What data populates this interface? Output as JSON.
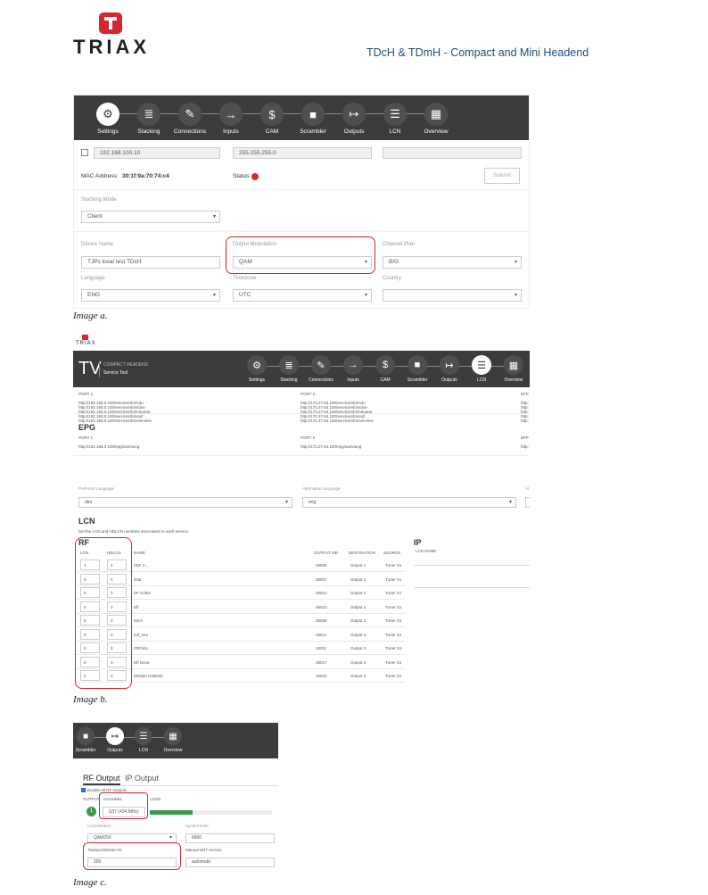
{
  "header": {
    "brand": "TRIAX",
    "doc_title": "TDcH & TDmH  -  Compact and Mini Headend"
  },
  "captions": {
    "a": "Image a.",
    "b": "Image b.",
    "c": "Image c."
  },
  "image_a": {
    "nav": [
      {
        "label": "Settings",
        "icon": "gear-icon",
        "glyph": "⚙",
        "active": true
      },
      {
        "label": "Stacking",
        "icon": "stack-icon",
        "glyph": "≣",
        "active": false
      },
      {
        "label": "Connections",
        "icon": "plug-icon",
        "glyph": "✎",
        "active": false
      },
      {
        "label": "Inputs",
        "icon": "input-icon",
        "glyph": "→",
        "active": false
      },
      {
        "label": "CAM",
        "icon": "cam-icon",
        "glyph": "$",
        "active": false
      },
      {
        "label": "Scrambler",
        "icon": "lock-icon",
        "glyph": "■",
        "active": false
      },
      {
        "label": "Outputs",
        "icon": "output-icon",
        "glyph": "↦",
        "active": false
      },
      {
        "label": "LCN",
        "icon": "list-icon",
        "glyph": "☰",
        "active": false
      },
      {
        "label": "Overview",
        "icon": "grid-icon",
        "glyph": "▦",
        "active": false
      }
    ],
    "ip": "192.168.100.10",
    "mask": "255.255.255.0",
    "mac_label": "MAC Address:",
    "mac_value": "30:1f:9a:70:74:c4",
    "status_label": "Status:",
    "submit": "Submit",
    "stacking_mode_label": "Stacking Mode",
    "stacking_mode_value": "Client",
    "device_name_label": "Device Name",
    "device_name_value": "TJPs local test TDcH",
    "output_mod_label": "Output Modulation",
    "output_mod_value": "QAM",
    "channel_plan_label": "Channel Plan",
    "channel_plan_value": "B/G",
    "language_label": "Language",
    "language_value": "ENG",
    "timezone_label": "Timezone",
    "timezone_value": "UTC",
    "country_label": "Country"
  },
  "image_b": {
    "small_brand": "TRIAX",
    "tv": "TV",
    "app_line1": "COMPACT HEADEND",
    "app_line2": "Service Tool",
    "nav": [
      "Settings",
      "Stacking",
      "Connections",
      "Inputs",
      "CAM",
      "Scrambler",
      "Outputs",
      "LCN",
      "Overview"
    ],
    "port1": "PORT 1",
    "port2": "PORT 2",
    "sfp": "SFP",
    "port1_urls": [
      "http://192.168.0.100/serviceinfo/m3u",
      "http://192.168.0.100/serviceinfo/vidue",
      "http://192.168.0.100/serviceinfo/m3uepp",
      "http://192.168.0.100/serviceinfo/xspf",
      "http://192.168.0.100/serviceinfo/overview"
    ],
    "port2_urls": [
      "http://172.27.64.100/serviceinfo/m3u",
      "http://172.27.64.100/serviceinfo/vidue",
      "http://172.27.64.100/serviceinfo/m3uepp",
      "http://172.27.64.100/serviceinfo/xspf",
      "http://172.27.64.100/serviceinfo/overview"
    ],
    "sfp_urls": [
      "http:",
      "http:",
      "http:",
      "http:",
      "http:"
    ],
    "epg_title": "EPG",
    "epg_port1": "http://192.168.0.100/epg/samsung",
    "epg_port2": "http://172.27.64.100/epg/samsung",
    "epg_sfp": "http:",
    "pref_lang_label": "Preferred Language",
    "pref_lang_value": "deu",
    "alt_lang_label": "Alternative Language",
    "alt_lang_value": "eng",
    "alt_cut": "Al",
    "lcn_title": "LCN",
    "lcn_desc": "Set the LCN and HDLCN numbers associated to each service.",
    "rf_title": "RF",
    "ip_title": "IP",
    "ip_cols": "LCN  NAME",
    "cols": {
      "lcn": "LCN",
      "hdlcn": "HDLCN",
      "name": "NAME",
      "sid": "OUTPUT SID",
      "dest": "DESTINATION",
      "src": "SOURCE"
    },
    "rows": [
      {
        "lcn": "4",
        "hdlcn": "4",
        "name": "ZDF 2...",
        "sid": "28006",
        "dest": "Output 1",
        "src": "Tuner S1"
      },
      {
        "lcn": "0",
        "hdlcn": "0",
        "name": "3sat",
        "sid": "28007",
        "dest": "Output 2",
        "src": "Tuner S1"
      },
      {
        "lcn": "0",
        "hdlcn": "0",
        "name": "DF Kultur",
        "sid": "28012",
        "dest": "Output 2",
        "src": "Tuner S1"
      },
      {
        "lcn": "0",
        "hdlcn": "0",
        "name": "Dlf",
        "sid": "28013",
        "dest": "Output 2",
        "src": "Tuner S1"
      },
      {
        "lcn": "0",
        "hdlcn": "0",
        "name": "KiKA",
        "sid": "28008",
        "dest": "Output 3",
        "src": "Tuner S1"
      },
      {
        "lcn": "0",
        "hdlcn": "0",
        "name": "zdf_neo",
        "sid": "28014",
        "dest": "Output 3",
        "src": "Tuner S1"
      },
      {
        "lcn": "0",
        "hdlcn": "0",
        "name": "ZDFinfo",
        "sid": "28011",
        "dest": "Output 3",
        "src": "Tuner S1"
      },
      {
        "lcn": "0",
        "hdlcn": "0",
        "name": "Dlf Nova",
        "sid": "28017",
        "dest": "Output 3",
        "src": "Tuner S1"
      },
      {
        "lcn": "0",
        "hdlcn": "0",
        "name": "DRadio DokDeb",
        "sid": "28015",
        "dest": "Output 3",
        "src": "Tuner S1"
      }
    ]
  },
  "image_c": {
    "nav": [
      {
        "label": "Scrambler",
        "glyph": "■",
        "icon": "lock-icon",
        "active": false
      },
      {
        "label": "Outputs",
        "glyph": "↦",
        "icon": "output-icon",
        "active": true
      },
      {
        "label": "LCN",
        "glyph": "☰",
        "icon": "list-icon",
        "active": false
      },
      {
        "label": "Overview",
        "glyph": "▦",
        "icon": "grid-icon",
        "active": false
      }
    ],
    "tab_rf": "RF Output",
    "tab_ip": "IP Output",
    "enable_all": "Enable All RF Outputs",
    "col_output": "OUTPUT",
    "col_channel": "CHANNEL",
    "col_load": "LOAD",
    "output_num": "1",
    "channel_value": "S37 (434 MHz)",
    "load_fraction": 0.35,
    "constellation_label": "Constellation",
    "constellation_value": "QAM256",
    "symbol_rate_label": "Symbol Rate",
    "symbol_rate_value": "6900",
    "ts_id_label": "Transportstream ID",
    "ts_id_value": "200",
    "sdt_label": "Manual SDT version",
    "sdt_value": "automatic"
  },
  "colors": {
    "accent_red": "#d7262e",
    "nav_dark": "#3c3c3c",
    "load_green": "#3a9a4a",
    "title_blue": "#1f4e79"
  }
}
